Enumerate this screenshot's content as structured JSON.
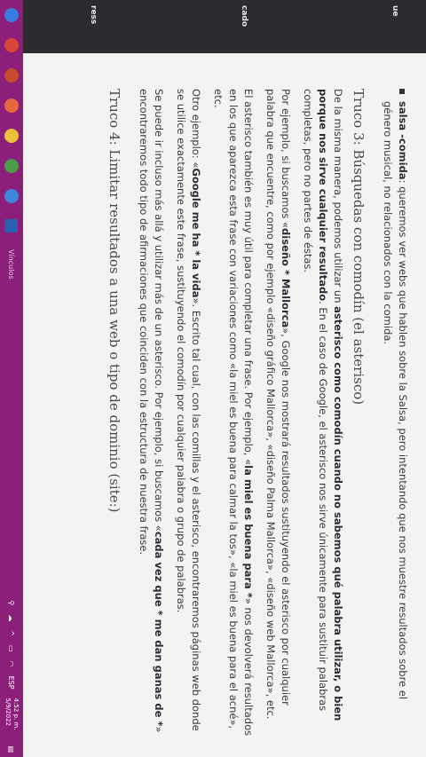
{
  "document": {
    "bullet_bold": "salsa -comida",
    "bullet_text": ": queremos ver webs que hablen sobre la Salsa, pero intentando que nos muestre resultados sobre el género musical, no relacionados con la comida.",
    "heading3": "Truco 3: Búsquedas con comodín (el asterisco)",
    "p1_a": "De la misma manera, podemos utilizar un ",
    "p1_b": "asterisco como comodín cuando no sabemos qué palabra utilizar, o bien porque nos sirve cualquier resultado",
    "p1_c": ". En el caso de Google, el asterisco nos sirve únicamente para sustituir palabras completas, pero no partes de éstas.",
    "p2_a": "Por ejemplo, si buscamos «",
    "p2_b": "diseño * Mallorca",
    "p2_c": "», Google nos mostrará resultados sustituyendo el asterisco por cualquier palabra que encuentre, como por ejemplo «diseño gráfico Mallorca», «diseño Palma Mallorca», «diseño web Mallorca», etc.",
    "p3_a": "El asterisco también es muy útil para completar una frase. Por ejemplo, «",
    "p3_b": "la miel es buena para *",
    "p3_c": "» nos devolverá resultados en los que aparezca esta frase con variaciones como «la miel es buena para calmar la tos», «la miel es buena para el acné», etc.",
    "p4_a": "Otro ejemplo: «",
    "p4_b": "Google me ha * la vida",
    "p4_c": "». Escrito tal cual, con las comillas y el asterisco, encontraremos páginas web donde se utilice exactamente este frase, sustituyendo el comodín por cualquier palabra o grupo de palabras.",
    "p5_a": "Se puede ir incluso más allá y utilizar más de un asterisco. Por ejemplo, si buscamos «",
    "p5_b": "cada vez que * me dan ganas de *",
    "p5_c": "» encontraremos todo tipo de afirmaciones que coinciden con la estructura de nuestra frase.",
    "heading4": "Truco 4: Limitar resultados a una web o tipo de dominio (site:)"
  },
  "sidebar": {
    "labels": [
      "ue",
      "cado",
      "ress"
    ]
  },
  "taskbar": {
    "vinculos": "Vínculos",
    "lang": "ESP",
    "time": "4:52 p. m.",
    "date": "5/9/2022"
  },
  "colors": {
    "taskbar": "#8b1f7a",
    "page": "#f5f3f1",
    "text": "#3b3843"
  }
}
